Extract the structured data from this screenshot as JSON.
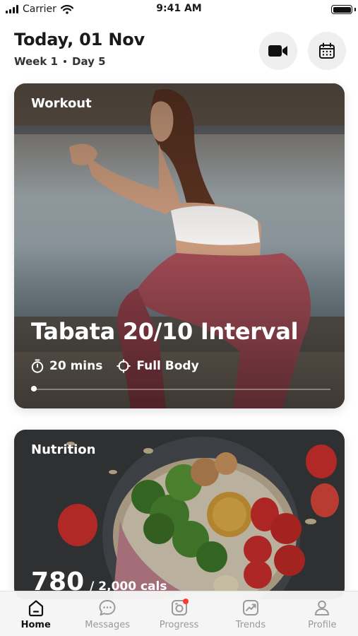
{
  "status_bar": {
    "carrier": "Carrier",
    "time": "9:41 AM"
  },
  "header": {
    "title": "Today, 01 Nov",
    "week": "Week 1",
    "day": "Day 5"
  },
  "workout": {
    "label": "Workout",
    "title": "Tabata 20/10 Interval",
    "duration": "20 mins",
    "focus": "Full Body"
  },
  "nutrition": {
    "label": "Nutrition",
    "calories": "780",
    "calories_total": "/ 2,000 cals"
  },
  "tabs": [
    {
      "label": "Home",
      "icon": "home-icon",
      "active": true
    },
    {
      "label": "Messages",
      "icon": "chat-bubble-icon",
      "active": false
    },
    {
      "label": "Progress",
      "icon": "progress-camera-icon",
      "active": false
    },
    {
      "label": "Trends",
      "icon": "trend-chart-icon",
      "active": false
    },
    {
      "label": "Profile",
      "icon": "person-icon",
      "active": false
    }
  ],
  "colors": {
    "accent": "#ff3b30",
    "active_tab": "#111111",
    "inactive_tab": "#9a9a9a"
  }
}
